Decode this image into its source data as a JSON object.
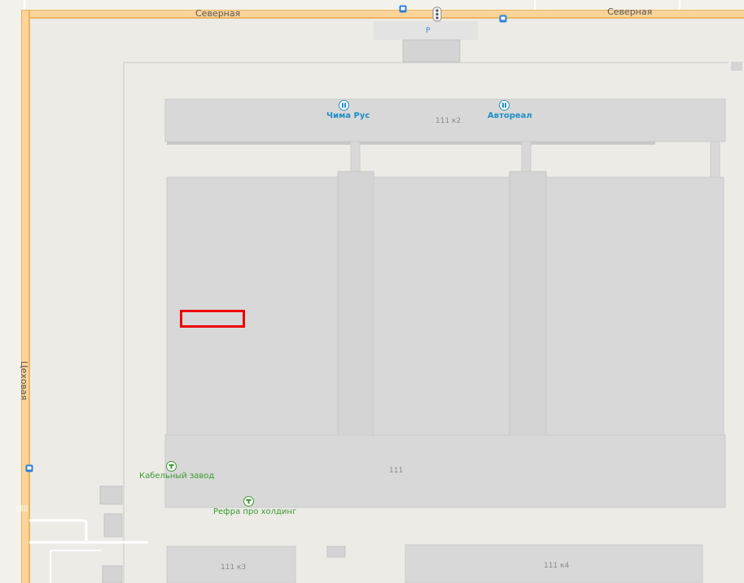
{
  "streets": {
    "north_left": "Северная",
    "north_right": "Северная",
    "west": "Цеховая"
  },
  "buildings": {
    "k2": "111 к2",
    "main": "111",
    "k3": "111 к3",
    "k4": "111 к4"
  },
  "parking": "P",
  "pois": {
    "chima": "Чима Рус",
    "avtoreal": "Автореал",
    "kabel": "Кабельный завод",
    "refra": "Рефра про холдинг"
  },
  "colors": {
    "road_fill": "#fbd49a",
    "road_edge": "#ecb463",
    "building": "#d8d8d8",
    "ground": "#ecebe6",
    "marker": "#ee0000",
    "poi_blue": "#1f8fc8",
    "poi_green": "#3b9a2f",
    "bus_stop": "#2f7fd8"
  }
}
